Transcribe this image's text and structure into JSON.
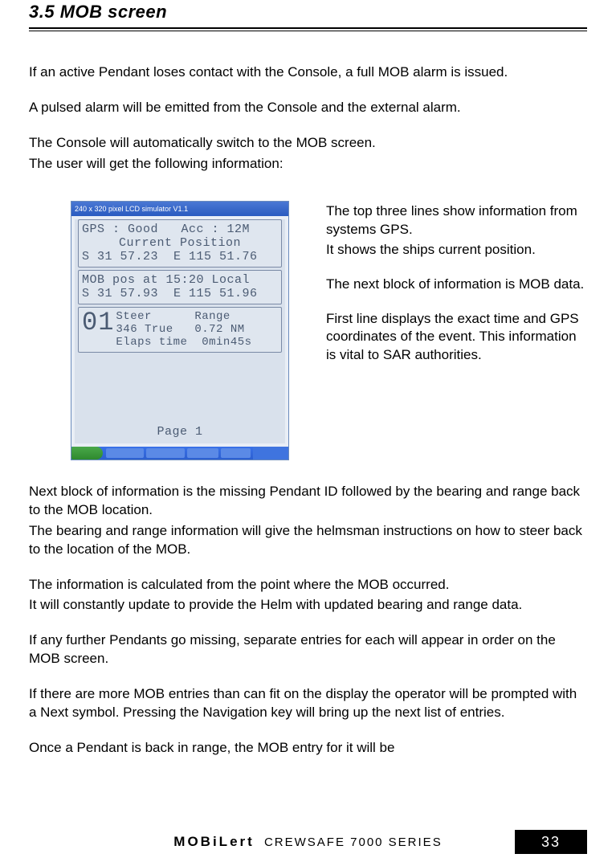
{
  "heading": "3.5 MOB screen",
  "intro": {
    "p1": "If an active Pendant loses contact with the Console, a full MOB alarm is issued.",
    "p2": "A pulsed alarm will be emitted from the Console and the external alarm.",
    "p3": "The Console will automatically switch to the MOB screen.",
    "p4": "The user will get the following information:"
  },
  "screenshot": {
    "title": "240 x 320 pixel LCD simulator V1.1",
    "gps": {
      "l1": "GPS : Good   Acc : 12M",
      "l2": "Current Position",
      "l3": "S 31 57.23  E 115 51.76"
    },
    "mob": {
      "l1": "MOB pos at 15:20 Local",
      "l2": "S 31 57.93  E 115 51.96"
    },
    "steer": {
      "id": "01",
      "h1": "Steer      Range",
      "h2": "346 True   0.72 NM",
      "h3": "Elaps time  0min45s"
    },
    "page": "Page 1"
  },
  "sidetext": {
    "p1": " The top three lines show information from systems GPS.",
    "p2": "It shows the ships current position.",
    "p3": "The next block of information is MOB data.",
    "p4": "First line displays the exact time and GPS coordinates of the event. This information is vital to SAR authorities."
  },
  "below": {
    "p1": "Next block of information is the missing Pendant ID followed by the bearing and range back to the MOB location.",
    "p2": "The bearing and range information will give the helmsman instructions on how to steer back to the location of the MOB.",
    "p3": "The information is calculated from the point where the MOB occurred.",
    "p4": "It will constantly update to provide the Helm with updated bearing and range data.",
    "p5": "If any further Pendants go missing, separate entries for each will appear in order on the MOB screen.",
    "p6": "If there are more MOB entries than can fit on the display the operator will be prompted with a Next symbol. Pressing the Navigation key will bring up the next list of entries.",
    "p7": "Once a Pendant is back in range, the MOB entry for it will be"
  },
  "footer": {
    "brand": "MOBiLert",
    "series": " CREWSAFE 7000 SERIES",
    "page": "33"
  }
}
